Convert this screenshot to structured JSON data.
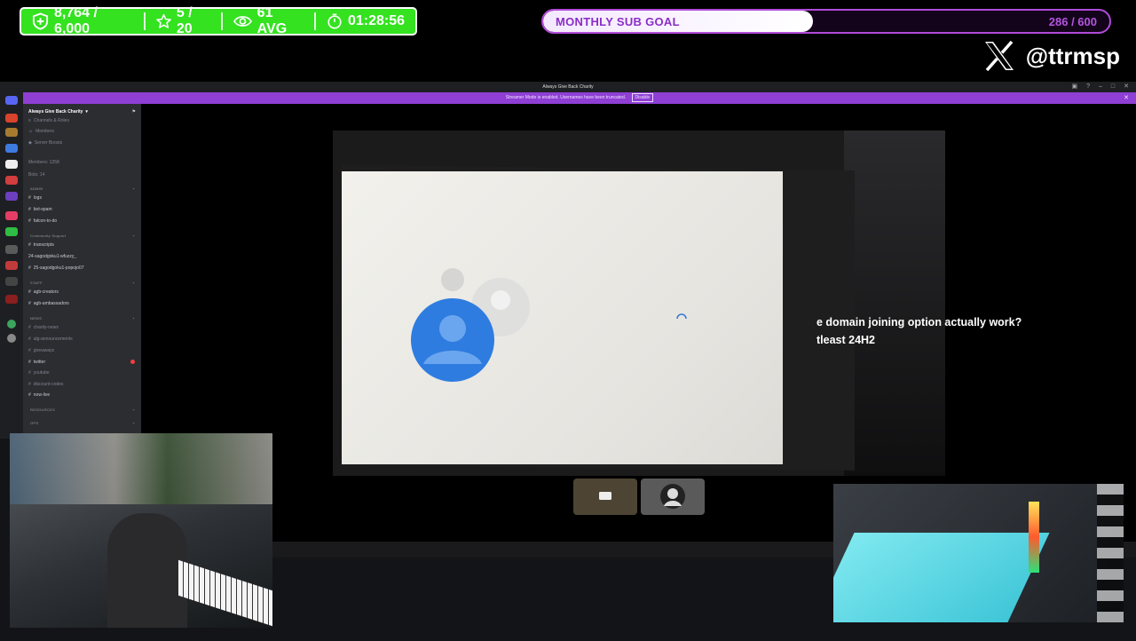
{
  "stats": {
    "points": "8,764 / 6,000",
    "stars": "5 / 20",
    "viewers": "61 AVG",
    "timer": "01:28:56",
    "points_icon": "shield-plus-icon",
    "stars_icon": "star-icon",
    "viewers_icon": "eye-icon",
    "timer_icon": "timer-icon"
  },
  "sub_goal": {
    "label": "MONTHLY SUB GOAL",
    "count": "286 / 600",
    "progress": 0.477
  },
  "social": {
    "handle": "@ttrmsp",
    "icon": "x-logo-icon"
  },
  "discord": {
    "window_title": "Always Give Back Charity",
    "banner_text": "Streamer Mode is enabled. Usernames have been truncated.",
    "banner_button": "Disable",
    "server_name": "Always Give Back Charity",
    "top_items": [
      "Channels & Roles",
      "Members",
      "Server Boosts"
    ],
    "members_label": "Members: 1258",
    "bots_label": "Bots: 14",
    "categories": {
      "admin": "ADMIN",
      "community": "Community Support",
      "staff": "STAFF",
      "news": "NEWS",
      "resources": "RESOURCES",
      "ops": "OPS"
    },
    "admin_channels": [
      "logs",
      "bot-spam",
      "falcon-to-do"
    ],
    "community_channels": [
      "transcripts",
      "24-sagodgoku1-wfuzzy_",
      "25-sagodgoku1-popojo07"
    ],
    "staff_channels": [
      "agb-creators",
      "agb-ambassadors"
    ],
    "news_channels": [
      "charity-news",
      "alg-announcements",
      "giveaways",
      "twitter",
      "youtube",
      "discount-codes",
      "now-live"
    ]
  },
  "video_overlay": {
    "line1": "e domain joining option actually work?",
    "line2": "tleast 24H2"
  },
  "colors": {
    "stats_green": "#34e21f",
    "goal_purple": "#b04bd8",
    "discord_banner": "#8f3fd4"
  }
}
